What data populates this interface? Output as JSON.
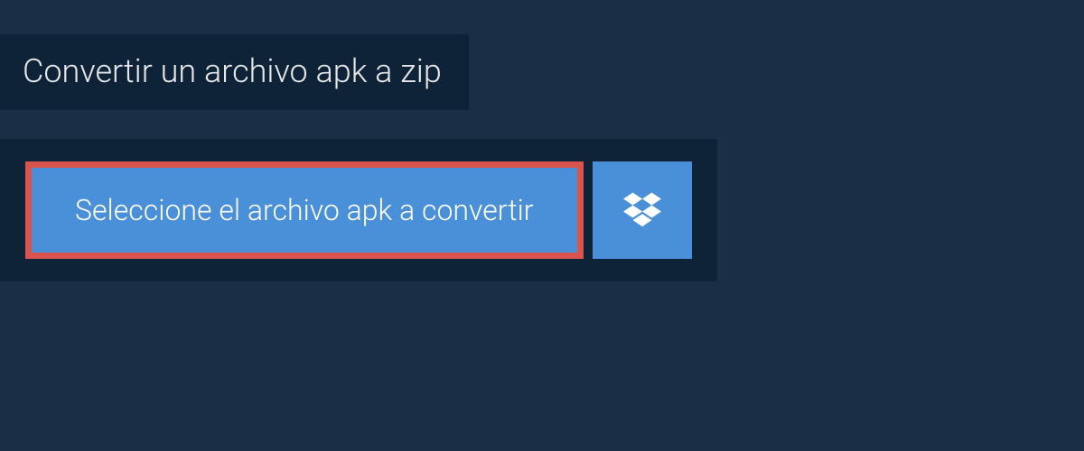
{
  "title": "Convertir un archivo apk a zip",
  "buttons": {
    "select_file_label": "Seleccione el archivo apk a convertir"
  },
  "colors": {
    "background": "#1a2f45",
    "panel": "#0f2338",
    "button": "#4a90d9",
    "highlight_border": "#d9544f"
  }
}
